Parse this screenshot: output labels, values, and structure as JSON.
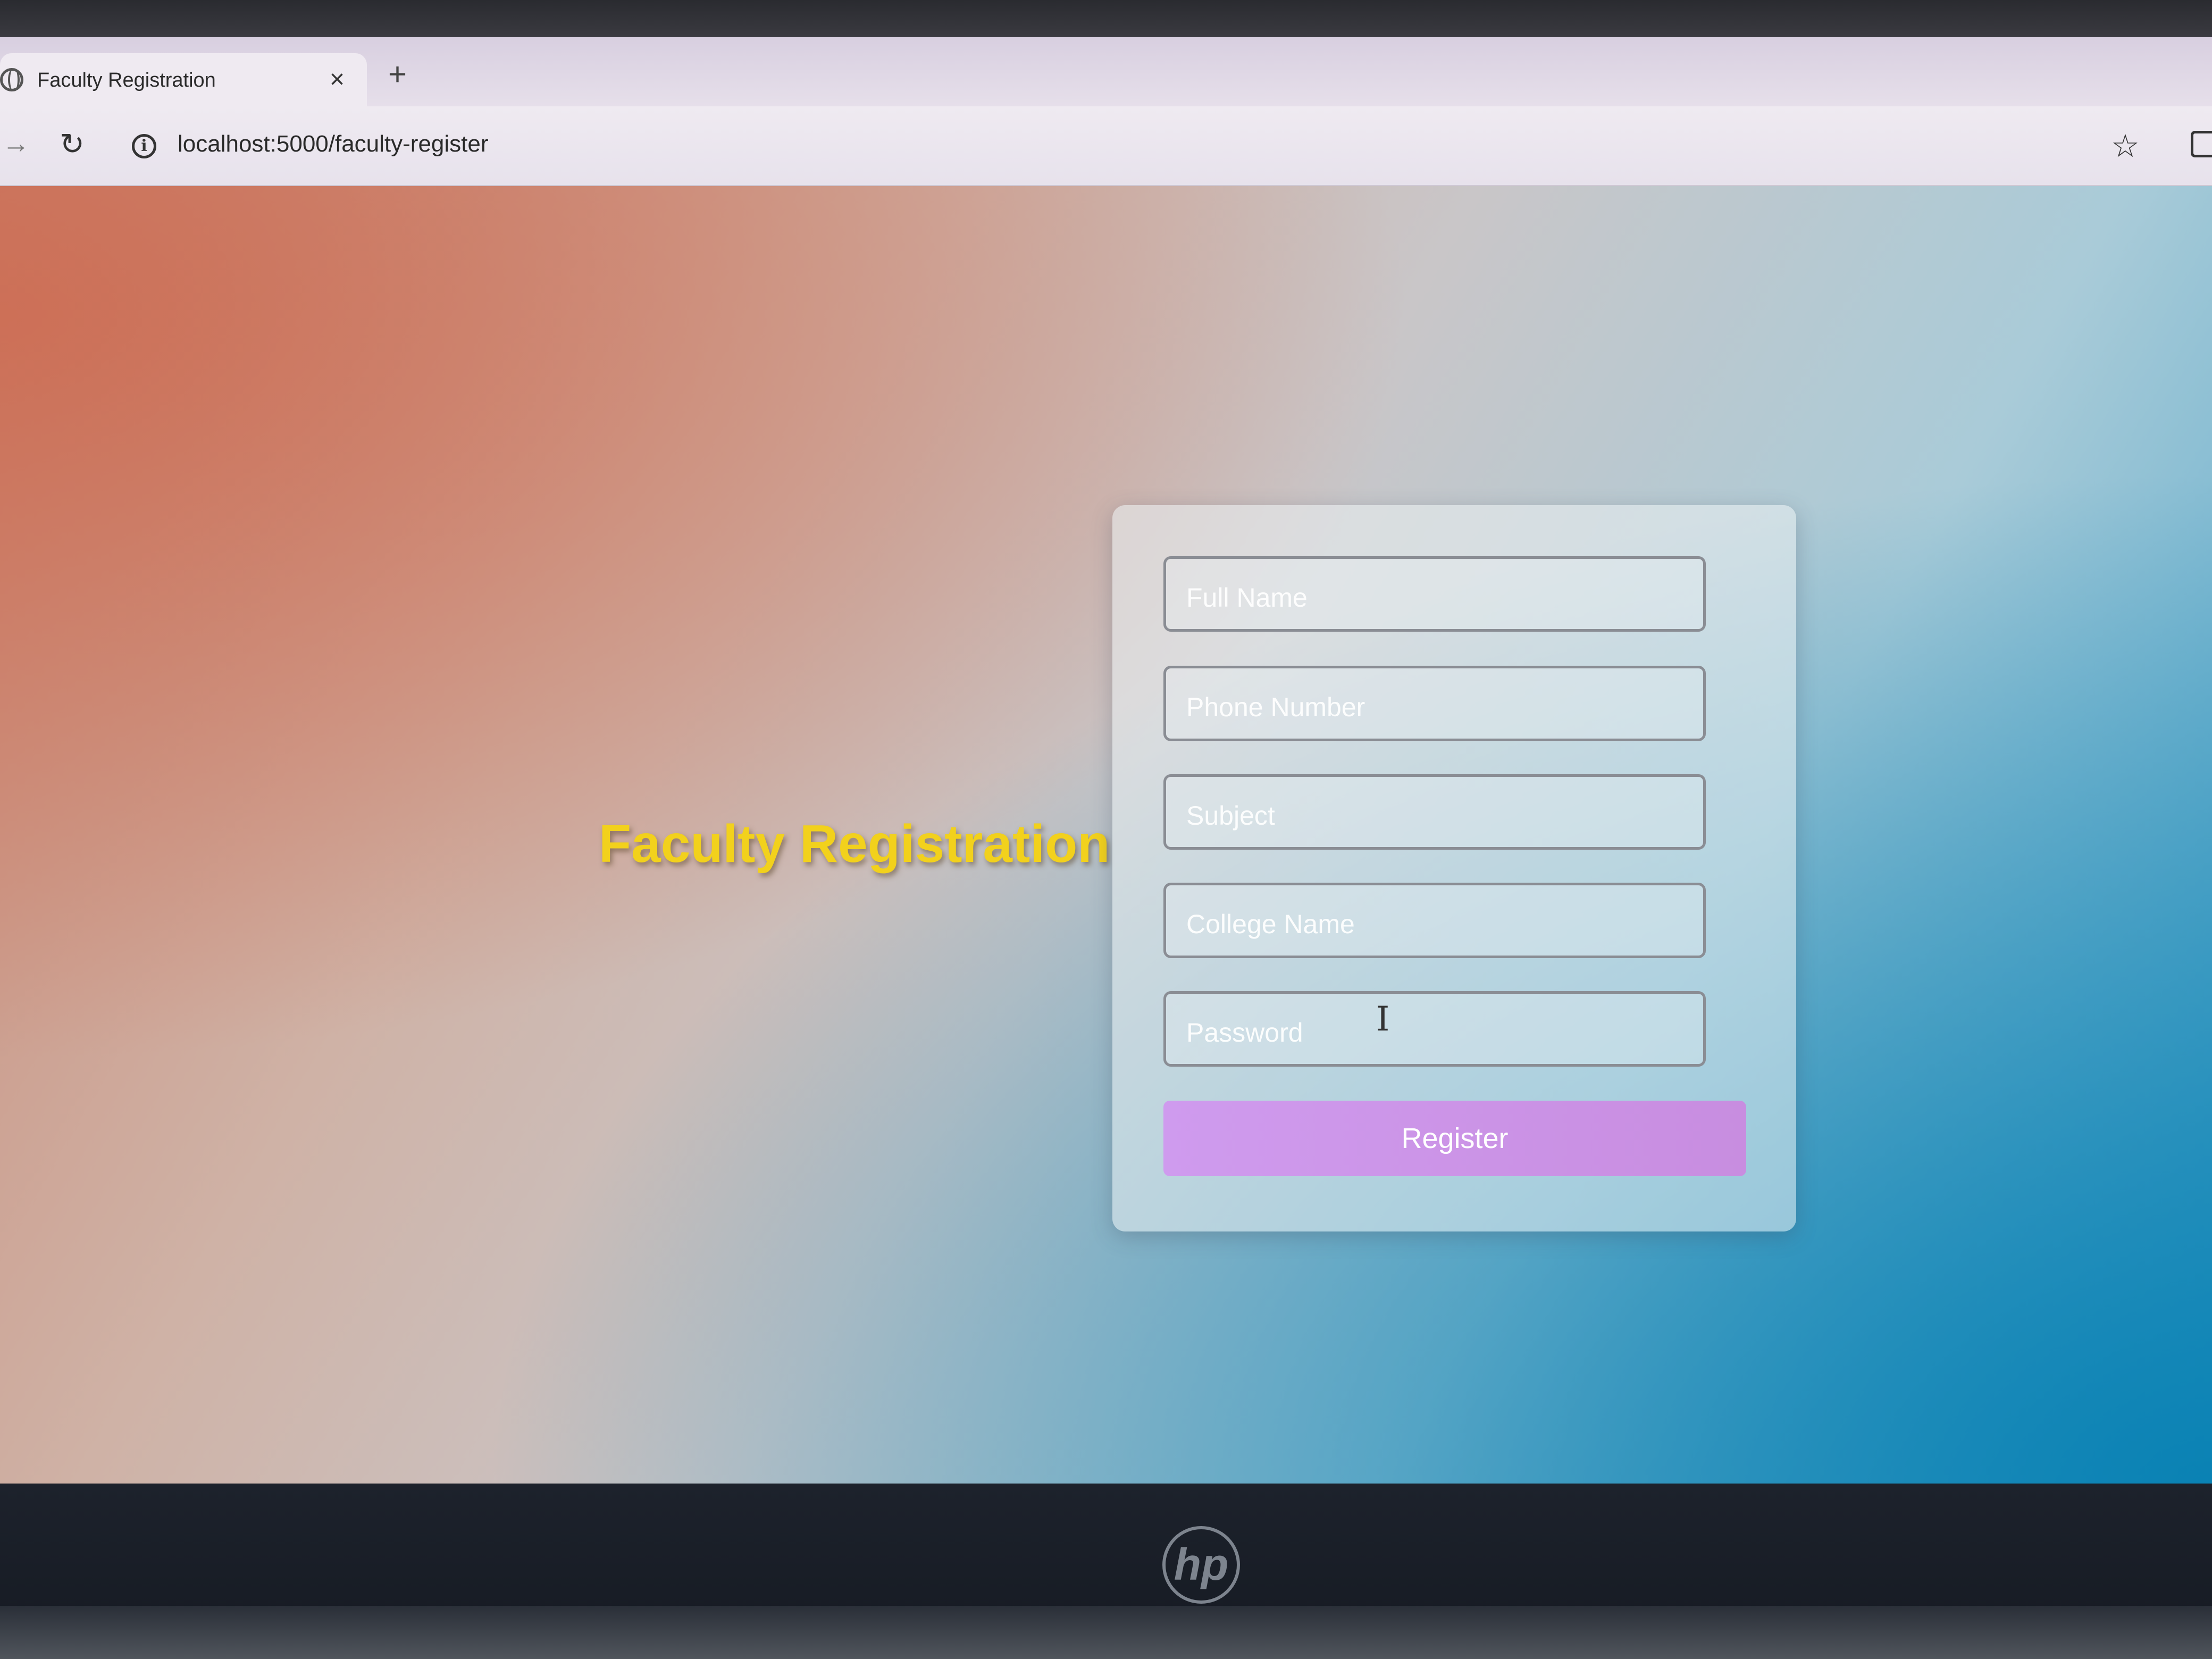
{
  "browser": {
    "tab_title": "Faculty Registration",
    "tab_close": "×",
    "new_tab": "+",
    "url": "localhost:5000/faculty-register",
    "icons": [
      "globe-icon",
      "close-icon",
      "plus-icon",
      "arrow-right-icon",
      "reload-icon",
      "info-icon",
      "star-icon",
      "extensions-icon"
    ]
  },
  "page": {
    "heading": "Faculty Registration",
    "heading_color": "#f2d11c",
    "form": {
      "fields": [
        {
          "name": "full-name",
          "placeholder": "Full Name"
        },
        {
          "name": "phone-number",
          "placeholder": "Phone Number"
        },
        {
          "name": "subject",
          "placeholder": "Subject"
        },
        {
          "name": "college-name",
          "placeholder": "College Name"
        },
        {
          "name": "password",
          "placeholder": "Password"
        }
      ],
      "submit_label": "Register",
      "submit_color": "#cf9bee"
    }
  },
  "device": {
    "brand_logo": "hp"
  }
}
